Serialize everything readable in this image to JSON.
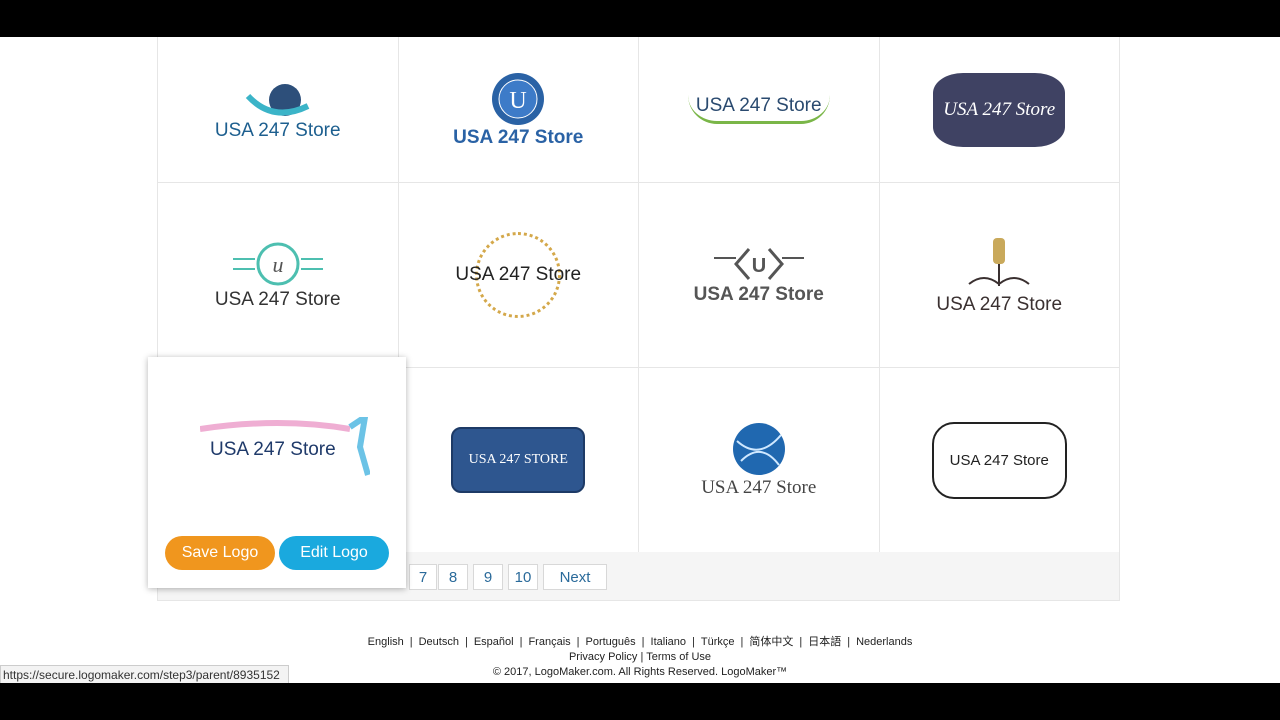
{
  "logos": [
    {
      "text": "USA 247 Store",
      "color": "#1d5f8f",
      "icon": "globe-swoosh-icon"
    },
    {
      "text": "USA 247 Store",
      "color": "#2a62a5",
      "icon": "u-badge-icon",
      "badge_letter": "U"
    },
    {
      "text": "USA 247 Store",
      "color": "#2a4a6f",
      "icon": "green-orbit-icon"
    },
    {
      "text": "USA 247 Store",
      "color": "#fff",
      "icon": "navy-emblem-icon"
    },
    {
      "text": "USA 247 Store",
      "color": "#333",
      "icon": "teal-u-monogram-icon",
      "badge_letter": "u"
    },
    {
      "text": "USA 247 Store",
      "color": "#222",
      "icon": "gold-swirl-icon"
    },
    {
      "text": "USA 247 Store",
      "color": "#555",
      "icon": "bracket-u-icon",
      "badge_letter": "U"
    },
    {
      "text": "USA 247 Store",
      "color": "#3a3030",
      "icon": "mannequin-icon"
    },
    {
      "text": "USA 247 Store",
      "color": "#1f3a6a",
      "icon": "dancer-brushstroke-icon"
    },
    {
      "text": "USA 247 STORE",
      "color": "#fff",
      "icon": "blue-label-icon"
    },
    {
      "text": "USA 247 Store",
      "color": "#444",
      "icon": "world-globe-icon"
    },
    {
      "text": "USA 247 Store",
      "color": "#222",
      "icon": "ornate-frame-icon"
    }
  ],
  "popup": {
    "save_label": "Save Logo",
    "edit_label": "Edit Logo"
  },
  "pagination": {
    "pages": [
      "7",
      "8",
      "9",
      "10"
    ],
    "next": "Next"
  },
  "footer": {
    "languages": [
      "English",
      "Deutsch",
      "Español",
      "Français",
      "Português",
      "Italiano",
      "Türkçe",
      "简体中文",
      "日本語",
      "Nederlands"
    ],
    "privacy": "Privacy Policy",
    "terms": "Terms of Use",
    "copyright": "© 2017, LogoMaker.com. All Rights Reserved. LogoMaker™"
  },
  "status_url": "https://secure.logomaker.com/step3/parent/8935152",
  "colors": {
    "save": "#f0961e",
    "edit": "#1aa9de"
  }
}
